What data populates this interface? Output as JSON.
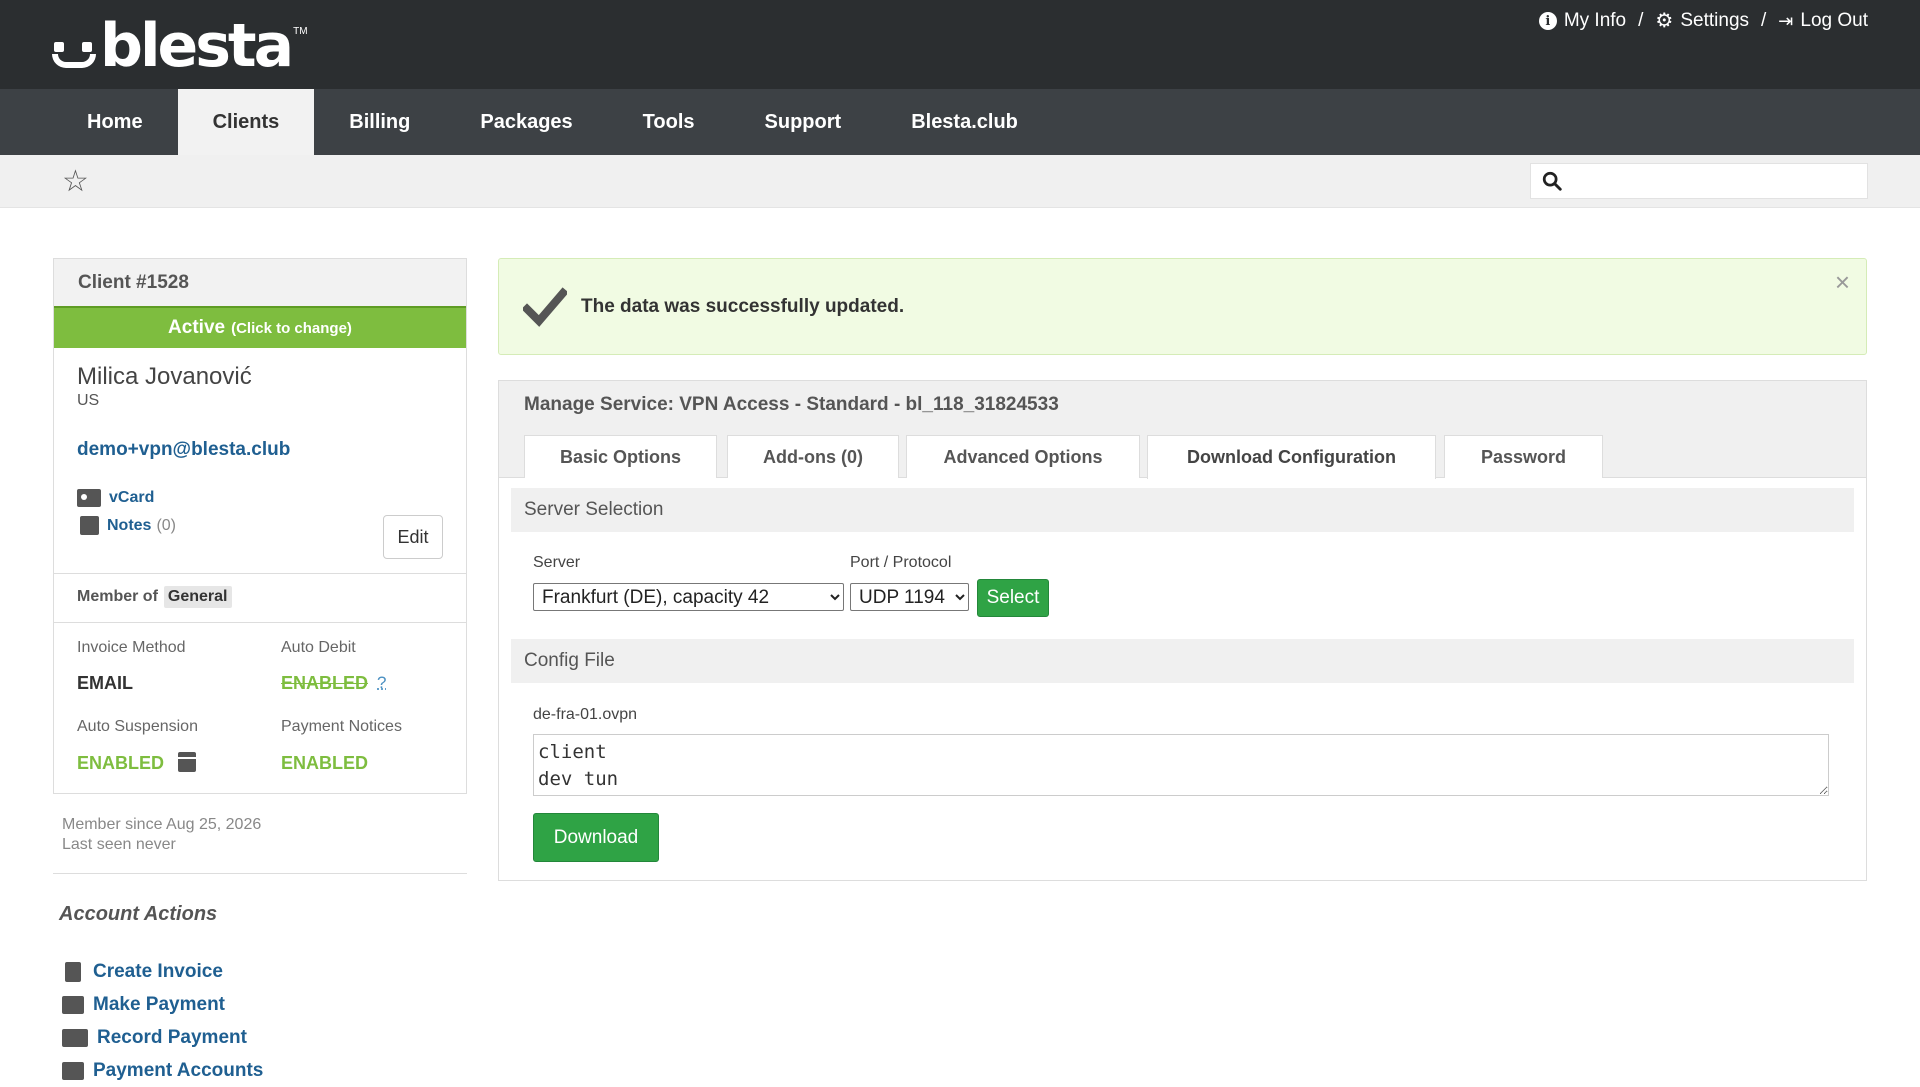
{
  "brand": {
    "name": "blesta",
    "tm": "TM"
  },
  "topnav": {
    "my_info": "My Info",
    "settings": "Settings",
    "log_out": "Log Out",
    "sep": "/"
  },
  "mainnav": {
    "items": [
      {
        "label": "Home",
        "active": false
      },
      {
        "label": "Clients",
        "active": true
      },
      {
        "label": "Billing",
        "active": false
      },
      {
        "label": "Packages",
        "active": false
      },
      {
        "label": "Tools",
        "active": false
      },
      {
        "label": "Support",
        "active": false
      },
      {
        "label": "Blesta.club",
        "active": false
      }
    ]
  },
  "search": {
    "placeholder": "",
    "value": ""
  },
  "client": {
    "header": "Client #1528",
    "status": "Active",
    "status_hint": "(Click to change)",
    "name": "Milica Jovanović",
    "country": "US",
    "email": "demo+vpn@blesta.club",
    "vcard": "vCard",
    "notes": "Notes",
    "notes_count": "(0)",
    "edit": "Edit",
    "member_of_label": "Member of",
    "group": "General",
    "invoice_method_label": "Invoice Method",
    "invoice_method": "EMAIL",
    "auto_debit_label": "Auto Debit",
    "auto_debit": "ENABLED",
    "auto_debit_help": "?",
    "auto_suspension_label": "Auto Suspension",
    "auto_suspension": "ENABLED",
    "payment_notices_label": "Payment Notices",
    "payment_notices": "ENABLED",
    "member_since": "Member since Aug 25, 2026",
    "last_seen": "Last seen never"
  },
  "account_actions": {
    "title": "Account Actions",
    "items": [
      {
        "label": "Create Invoice",
        "icon": "invoice-icon"
      },
      {
        "label": "Make Payment",
        "icon": "credit-card-icon"
      },
      {
        "label": "Record Payment",
        "icon": "money-icon"
      },
      {
        "label": "Payment Accounts",
        "icon": "bank-icon"
      }
    ]
  },
  "alert": {
    "message": "The data was successfully updated.",
    "close": "×"
  },
  "service": {
    "title": "Manage Service: VPN Access - Standard - bl_118_31824533",
    "tabs": [
      {
        "label": "Basic Options",
        "active": false
      },
      {
        "label": "Add-ons (0)",
        "active": false
      },
      {
        "label": "Advanced Options",
        "active": false
      },
      {
        "label": "Download Configuration",
        "active": true
      },
      {
        "label": "Password",
        "active": false
      }
    ],
    "server_section": "Server Selection",
    "server_label": "Server",
    "server_value": "Frankfurt (DE), capacity 42",
    "port_label": "Port / Protocol",
    "port_value": "UDP 1194",
    "select_button": "Select",
    "config_section": "Config File",
    "config_filename": "de-fra-01.ovpn",
    "config_content": "client\ndev tun",
    "download_button": "Download"
  },
  "colors": {
    "header_bg": "#2b2e30",
    "nav_bg": "#3d4145",
    "status_green": "#7ebd3f",
    "button_green": "#2fa345",
    "link_blue": "#1f5f91",
    "alert_bg": "#f1fbe3"
  }
}
